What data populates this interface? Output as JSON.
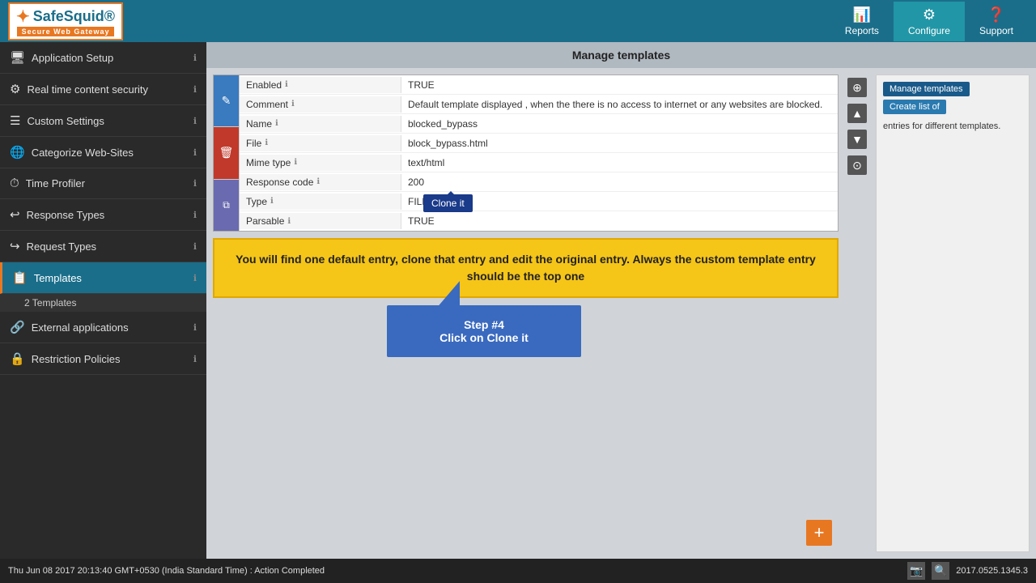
{
  "nav": {
    "logo_title": "SafeSquid®",
    "logo_subtitle": "Secure Web Gateway",
    "reports_label": "Reports",
    "configure_label": "Configure",
    "support_label": "Support"
  },
  "sidebar": {
    "items": [
      {
        "id": "application-setup",
        "icon": "🖥",
        "label": "Application Setup",
        "active": false
      },
      {
        "id": "real-time-content",
        "icon": "⚙",
        "label": "Real time content security",
        "active": false
      },
      {
        "id": "custom-settings",
        "icon": "☰",
        "label": "Custom Settings",
        "active": false
      },
      {
        "id": "categorize-websites",
        "icon": "🌐",
        "label": "Categorize Web-Sites",
        "active": false
      },
      {
        "id": "time-profiler",
        "icon": "⏱",
        "label": "Time Profiler",
        "active": false
      },
      {
        "id": "response-types",
        "icon": "↩",
        "label": "Response Types",
        "active": false
      },
      {
        "id": "request-types",
        "icon": "↪",
        "label": "Request Types",
        "active": false
      },
      {
        "id": "templates",
        "icon": "📋",
        "label": "Templates",
        "active": true
      },
      {
        "id": "external-applications",
        "icon": "🔗",
        "label": "External applications",
        "active": false
      },
      {
        "id": "restriction-policies",
        "icon": "🔒",
        "label": "Restriction Policies",
        "active": false
      }
    ],
    "templates_sub": "2 Templates"
  },
  "page_header": "Manage templates",
  "right_panel": {
    "tab1": "Manage templates",
    "tab2": "Create list of",
    "description": "entries for different templates."
  },
  "table": {
    "fields": [
      {
        "name": "Enabled",
        "value": "TRUE"
      },
      {
        "name": "Comment",
        "value": "Default template displayed , when the there is no access to internet or any websites are blocked."
      },
      {
        "name": "Name",
        "value": "blocked_bypass"
      },
      {
        "name": "File",
        "value": "block_bypass.html"
      },
      {
        "name": "Mime type",
        "value": "text/html"
      },
      {
        "name": "Response code",
        "value": "200"
      },
      {
        "name": "Type",
        "value": "FILE"
      },
      {
        "name": "Parsable",
        "value": "TRUE"
      }
    ]
  },
  "clone_tooltip": "Clone it",
  "step": {
    "line1": "Step #4",
    "line2": "Click on  Clone it"
  },
  "notice": "You will find one default entry, clone that entry and edit the original entry. Always the custom template entry should be the top one",
  "add_btn": "+",
  "status_bar": {
    "left": "Thu Jun 08 2017 20:13:40 GMT+0530 (India Standard Time) : Action Completed",
    "version": "2017.0525.1345.3"
  }
}
